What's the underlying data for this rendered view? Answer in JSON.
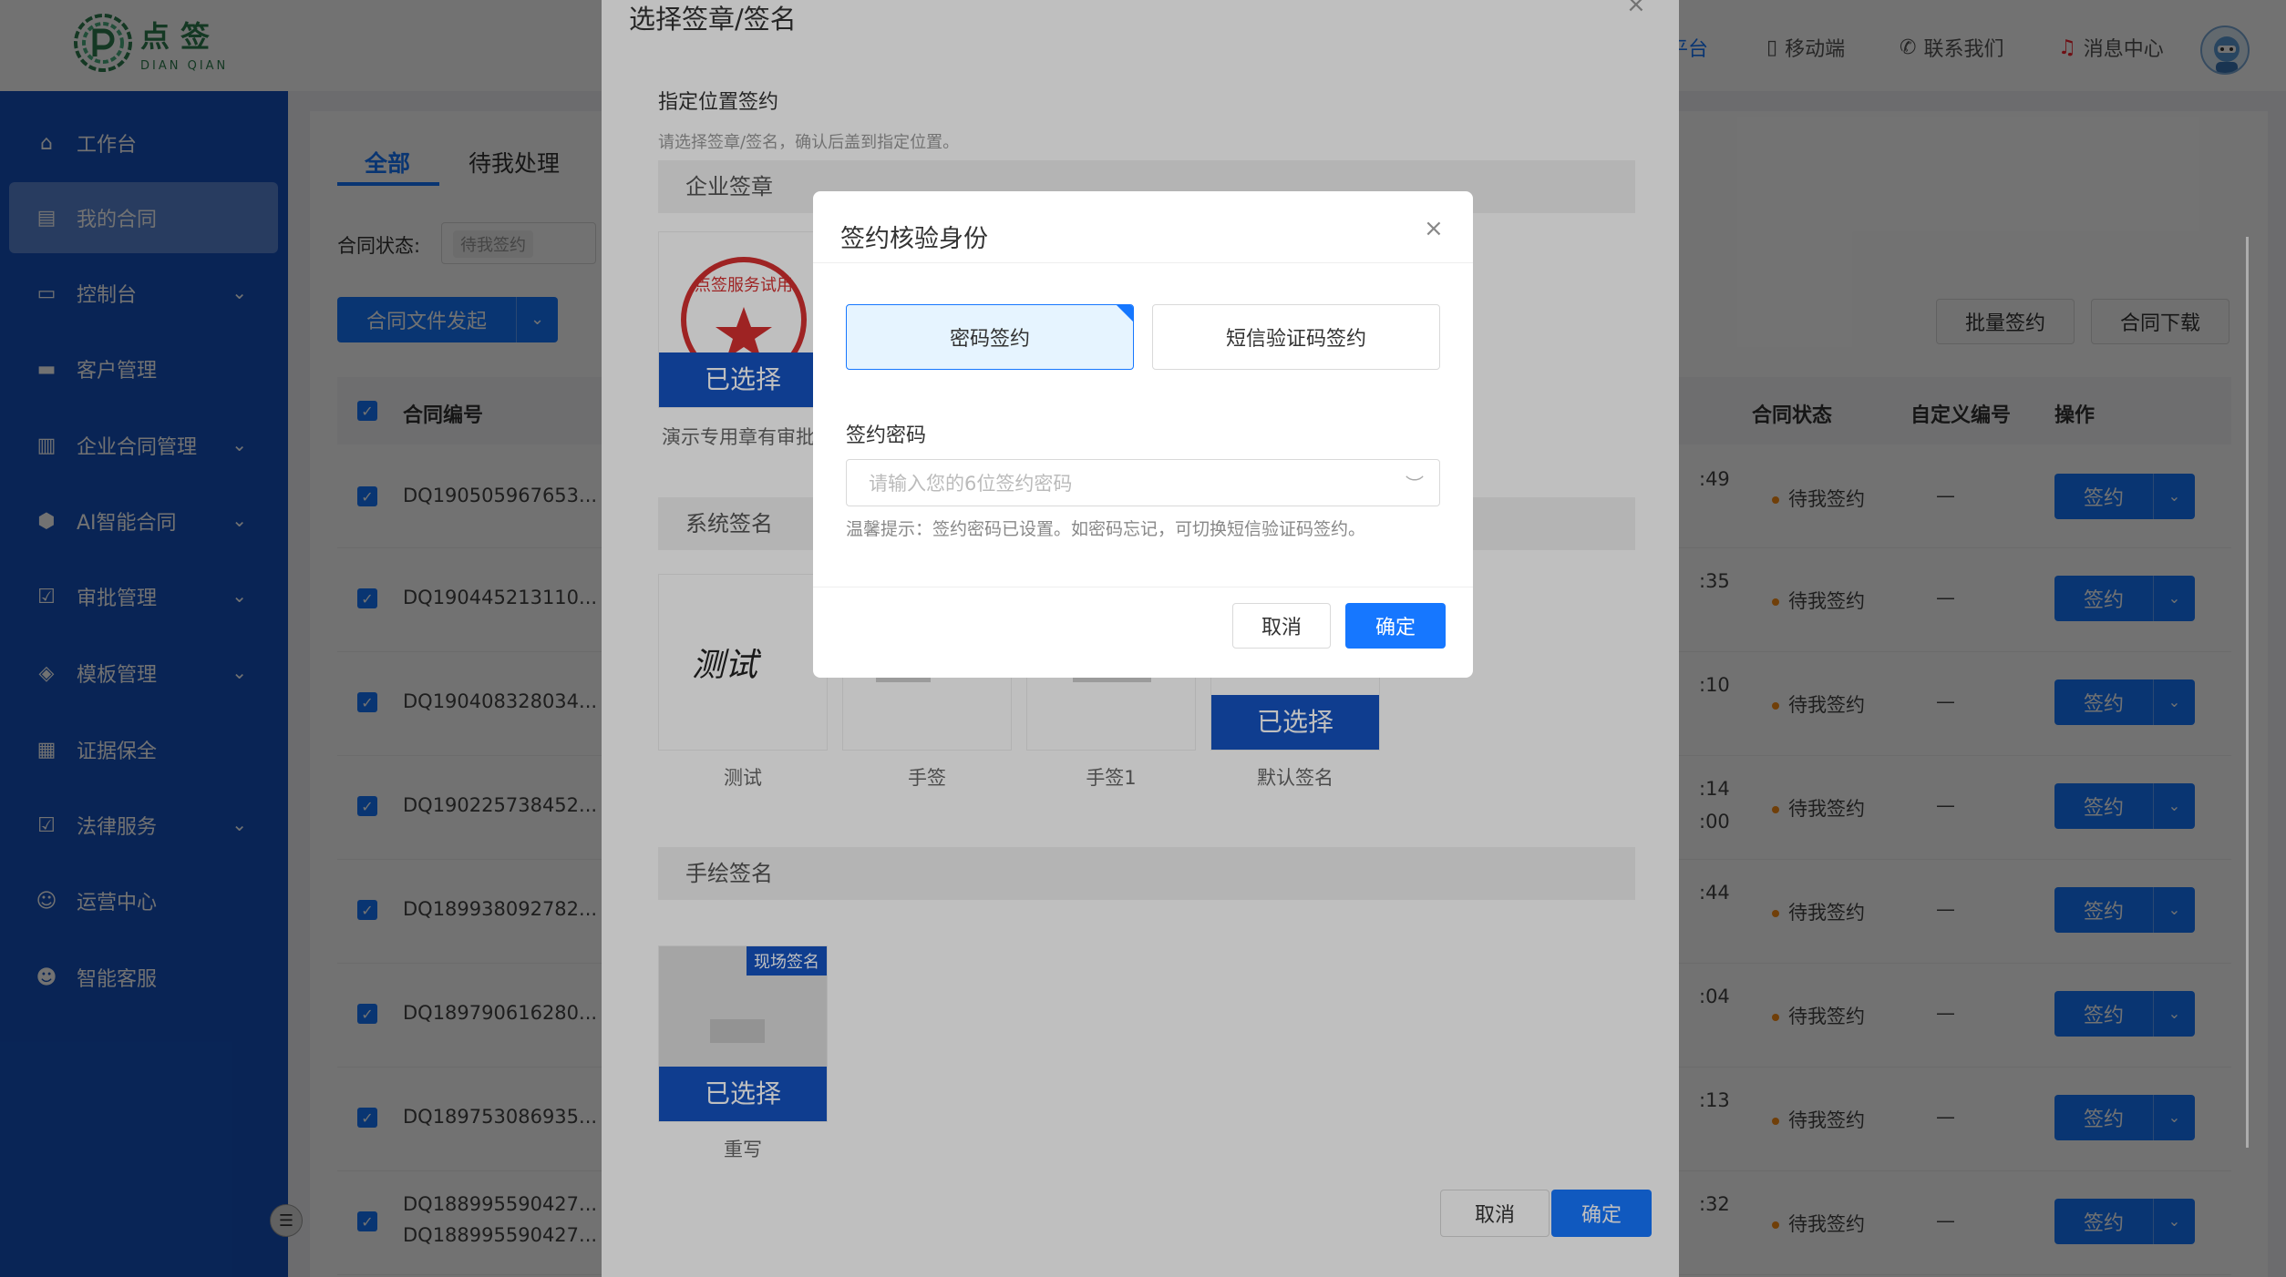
{
  "header": {
    "logo_cn": "点签",
    "logo_en": "DIAN QIAN",
    "nav": {
      "platform": "平台",
      "mobile": "移动端",
      "contact": "联系我们",
      "messages": "消息中心"
    }
  },
  "sidebar": {
    "items": [
      {
        "label": "工作台",
        "icon": "home-icon"
      },
      {
        "label": "我的合同",
        "icon": "contract-icon",
        "active": true
      },
      {
        "label": "控制台",
        "icon": "console-icon"
      },
      {
        "label": "客户管理",
        "icon": "customer-icon"
      },
      {
        "label": "企业合同管理",
        "icon": "enterprise-contract-icon"
      },
      {
        "label": "AI智能合同",
        "icon": "ai-icon"
      },
      {
        "label": "审批管理",
        "icon": "approval-icon"
      },
      {
        "label": "模板管理",
        "icon": "template-icon"
      },
      {
        "label": "证据保全",
        "icon": "evidence-icon"
      },
      {
        "label": "法律服务",
        "icon": "legal-icon"
      },
      {
        "label": "运营中心",
        "icon": "operations-icon"
      },
      {
        "label": "智能客服",
        "icon": "robot-icon"
      }
    ]
  },
  "main": {
    "tabs": [
      "全部",
      "待我处理"
    ],
    "status_label": "合同状态:",
    "status_tag": "待我签约",
    "launch_button": "合同文件发起",
    "batch_sign": "批量签约",
    "download": "合同下载",
    "columns": {
      "contract_no": "合同编号",
      "status": "合同状态",
      "custom_no": "自定义编号",
      "action": "操作"
    },
    "rows": [
      {
        "no": "DQ190505967653...",
        "time": ":49",
        "status": "待我签约",
        "custom": "—",
        "action": "签约"
      },
      {
        "no": "DQ190445213110...",
        "time": ":35",
        "status": "待我签约",
        "custom": "—",
        "action": "签约"
      },
      {
        "no": "DQ190408328034...",
        "time": ":10",
        "status": "待我签约",
        "custom": "—",
        "action": "签约"
      },
      {
        "no": "DQ190225738452...",
        "time": ":14",
        "time2": ":00",
        "status": "待我签约",
        "custom": "—",
        "action": "签约"
      },
      {
        "no": "DQ189938092782...",
        "time": ":44",
        "status": "待我签约",
        "custom": "—",
        "action": "签约"
      },
      {
        "no": "DQ189790616280...",
        "time": ":04",
        "status": "待我签约",
        "custom": "—",
        "action": "签约"
      },
      {
        "no": "DQ189753086935...",
        "time": ":13",
        "status": "待我签约",
        "custom": "—",
        "action": "签约"
      },
      {
        "no": "DQ188995590427...",
        "no2": "DQ188995590427...",
        "time": ":32",
        "status": "待我签约",
        "custom": "—",
        "action": "签约"
      }
    ]
  },
  "seal_dialog": {
    "title": "选择签章/签名",
    "subtitle": "指定位置签约",
    "hint": "请选择签章/签名，确认后盖到指定位置。",
    "sections": {
      "enterprise": "企业签章",
      "system": "系统签名",
      "handwritten": "手绘签名"
    },
    "enterprise_cards": [
      {
        "label": "演示专用章有审批",
        "selected": "已选择",
        "stamp_text": "点签服务试用"
      }
    ],
    "system_cards": [
      {
        "label": "测试",
        "handwriting": "测试"
      },
      {
        "label": "手签"
      },
      {
        "label": "手签1"
      },
      {
        "label": "默认签名",
        "selected": "已选择"
      }
    ],
    "handwritten_cards": [
      {
        "label": "重写",
        "badge": "现场签名",
        "selected": "已选择"
      }
    ],
    "cancel": "取消",
    "ok": "确定"
  },
  "verify_modal": {
    "title": "签约核验身份",
    "tab_password": "密码签约",
    "tab_sms": "短信验证码签约",
    "password_label": "签约密码",
    "password_placeholder": "请输入您的6位签约密码",
    "hint": "温馨提示：签约密码已设置。如密码忘记，可切换短信验证码签约。",
    "cancel": "取消",
    "ok": "确定"
  },
  "colors": {
    "primary": "#1677ff",
    "sidebar": "#1552bf",
    "pending_dot": "#fa8c16"
  }
}
